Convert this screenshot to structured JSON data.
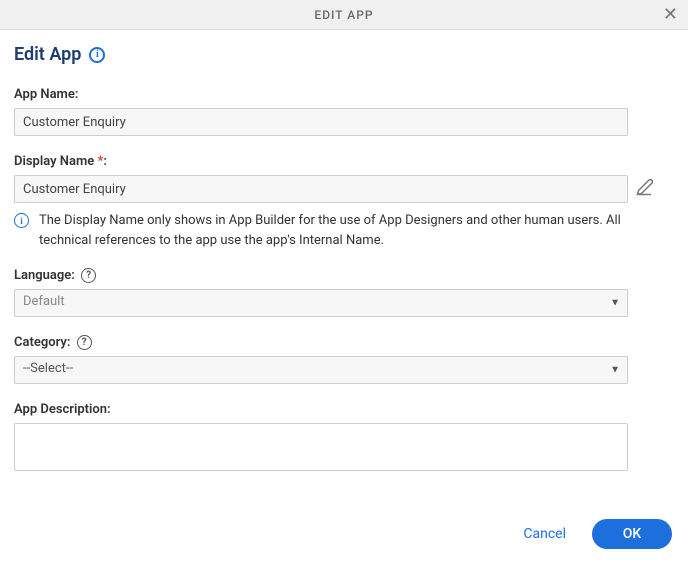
{
  "header": {
    "title": "EDIT APP"
  },
  "pageTitle": "Edit App",
  "form": {
    "appName": {
      "label": "App Name:",
      "value": "Customer Enquiry"
    },
    "displayName": {
      "label": "Display Name ",
      "required": "*",
      "labelSuffix": ":",
      "value": "Customer Enquiry",
      "info": "The Display Name only shows in App Builder for the use of App Designers and other human users. All technical references to the app use the app's Internal Name."
    },
    "language": {
      "label": "Language:",
      "value": "Default"
    },
    "category": {
      "label": "Category:",
      "value": "--Select--"
    },
    "appDescription": {
      "label": "App Description:",
      "value": ""
    }
  },
  "footer": {
    "cancel": "Cancel",
    "ok": "OK"
  }
}
